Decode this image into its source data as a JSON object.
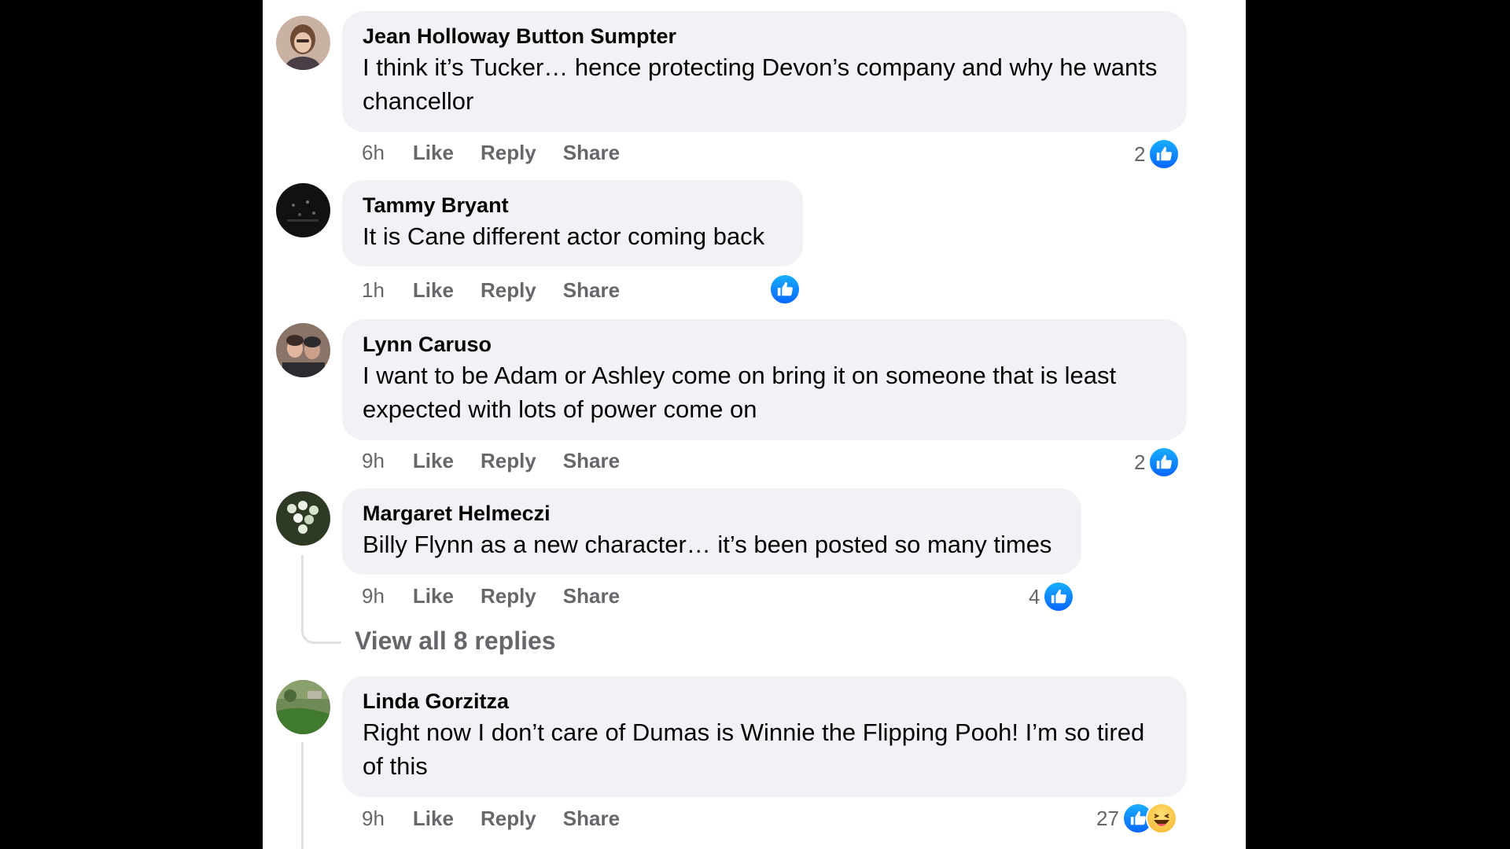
{
  "comments": [
    {
      "author": "Jean Holloway Button Sumpter",
      "text": "I think it’s Tucker… hence protecting Devon’s company and why he wants chancellor",
      "time": "6h",
      "like": "Like",
      "reply": "Reply",
      "share": "Share",
      "reaction_count": "2",
      "reactions": [
        "like-icon"
      ]
    },
    {
      "author": "Tammy Bryant",
      "text": "It is Cane different actor coming back",
      "time": "1h",
      "like": "Like",
      "reply": "Reply",
      "share": "Share",
      "reaction_count": "",
      "reactions": [
        "like-icon"
      ]
    },
    {
      "author": "Lynn Caruso",
      "text": "I want to be Adam or Ashley come on bring it on someone that is least expected with lots of power come on",
      "time": "9h",
      "like": "Like",
      "reply": "Reply",
      "share": "Share",
      "reaction_count": "2",
      "reactions": [
        "like-icon"
      ]
    },
    {
      "author": "Margaret Helmeczi",
      "text": "Billy Flynn as a new character… it’s been posted so many times",
      "time": "9h",
      "like": "Like",
      "reply": "Reply",
      "share": "Share",
      "reaction_count": "4",
      "reactions": [
        "like-icon"
      ],
      "view_replies": "View all 8 replies"
    },
    {
      "author": "Linda Gorzitza",
      "text": "Right now I don’t care of Dumas is Winnie the Flipping Pooh! I’m so tired of this",
      "time": "9h",
      "like": "Like",
      "reply": "Reply",
      "share": "Share",
      "reaction_count": "27",
      "reactions": [
        "like-icon",
        "haha-icon"
      ]
    }
  ],
  "colors": {
    "background": "#000000",
    "panel": "#ffffff",
    "bubble": "#f0f2f5",
    "secondary_text": "#65676b",
    "like_blue": "#0866ff"
  }
}
